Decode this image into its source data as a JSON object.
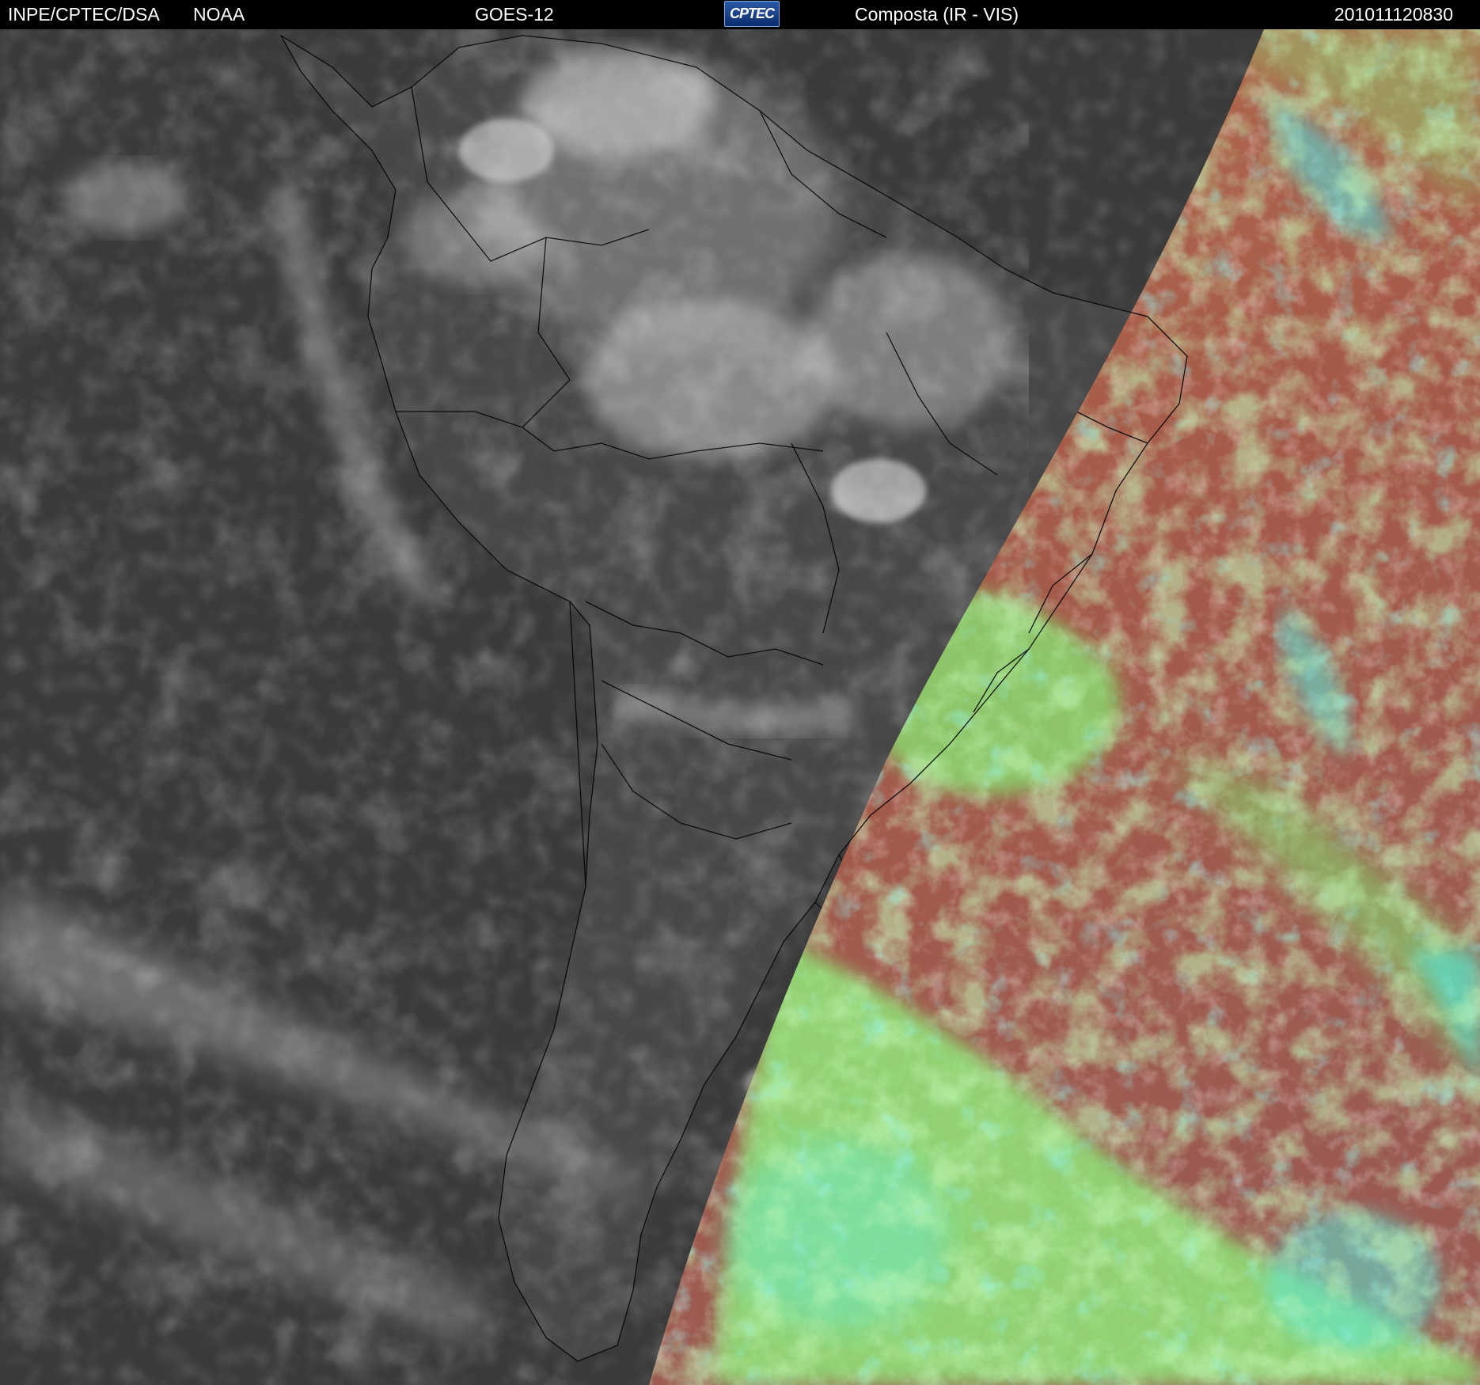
{
  "header": {
    "source": "INPE/CPTEC/DSA",
    "agency": "NOAA",
    "satellite": "GOES-12",
    "logo_text": "CPTEC",
    "product": "Composta (IR - VIS)",
    "timestamp": "201011120830"
  },
  "map": {
    "region": "South America",
    "night_side": "IR grayscale",
    "day_side": "VIS false color",
    "colors": {
      "ocean_night": "#3b3b3b",
      "land_night": "#494949",
      "cloud_night": "#d8d8d8",
      "ocean_day": "#a85a4a",
      "cloud_day_low": "#8cf07a",
      "cloud_day_high": "#4ee8e0",
      "border": "#000000"
    }
  }
}
